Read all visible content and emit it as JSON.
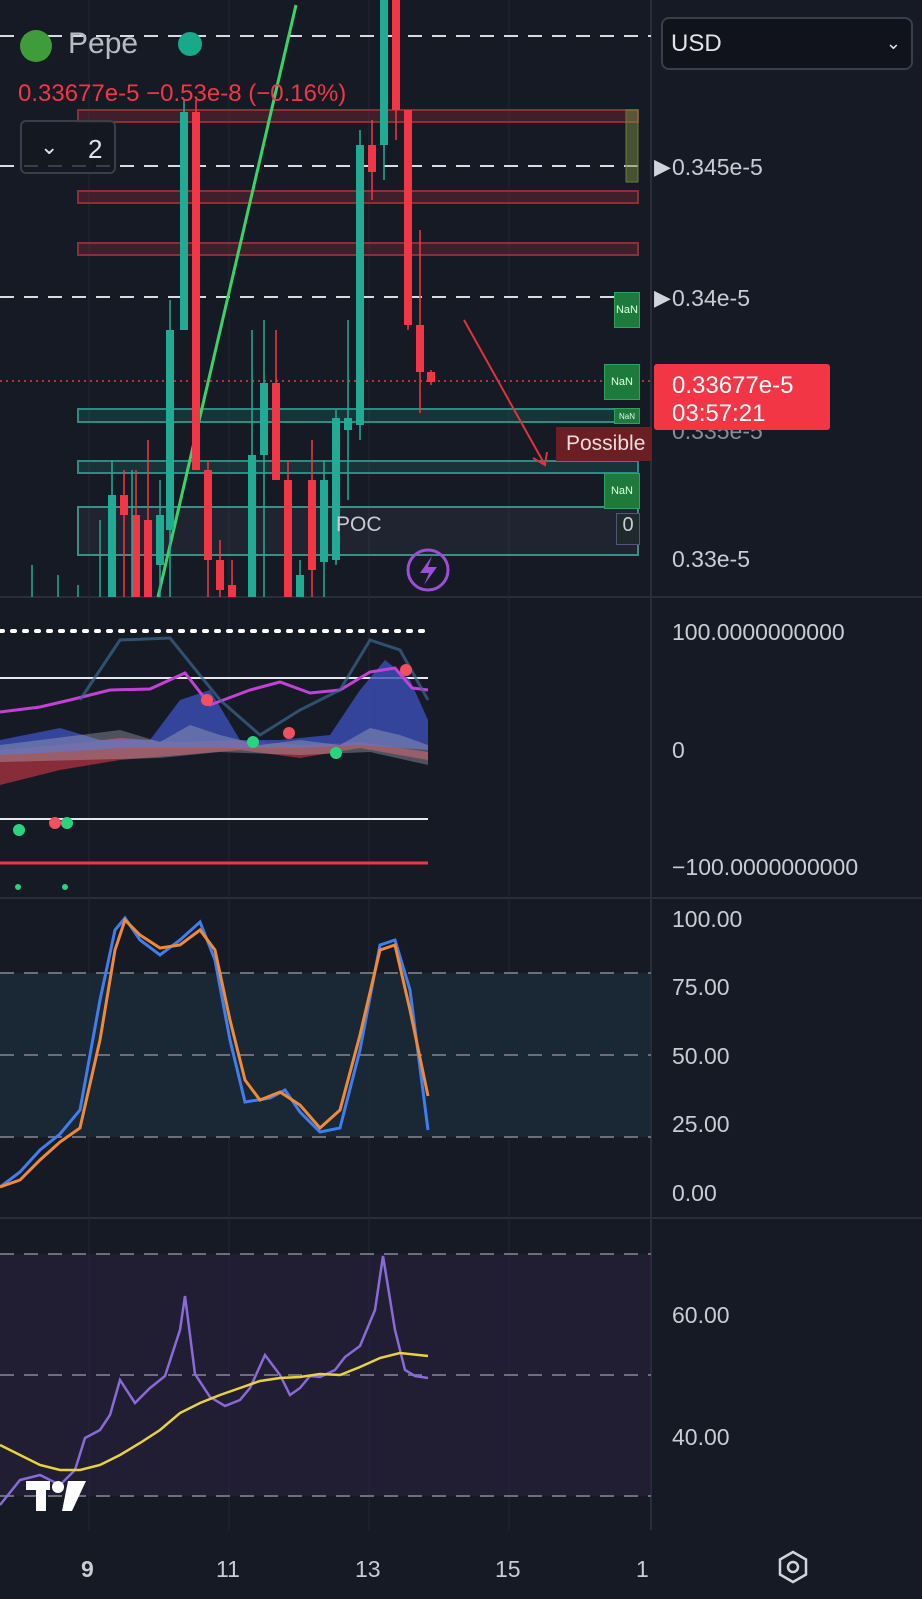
{
  "symbol": {
    "name": "Pepe",
    "quote": "0.33677e-5",
    "change": "−0.53e-8",
    "change_pct": "(−0.16%)",
    "icon": "pepe-frog-icon"
  },
  "legend": {
    "collapsed_count": "2",
    "chevron": "chevron-down-icon"
  },
  "currency": {
    "value": "USD",
    "chevron": "⌄"
  },
  "price_axis": {
    "labels": [
      "0.345e-5",
      "0.34e-5",
      "0.33e-5"
    ],
    "hidden_label": "0.335e-5"
  },
  "last_price": {
    "value": "0.33677e-5",
    "countdown": "03:57:21",
    "color": "#f23645"
  },
  "annotations": {
    "possible": "Possible",
    "poc": "POC",
    "poc_value": "0",
    "nan": "NaN"
  },
  "indicator1_axis": {
    "top": "100.0000000000",
    "mid": "0",
    "bottom": "−100.0000000000"
  },
  "stoch_axis": {
    "labels": [
      "100.00",
      "75.00",
      "50.00",
      "25.00",
      "0.00"
    ]
  },
  "rsi_axis": {
    "labels": [
      "60.00",
      "40.00"
    ]
  },
  "time_axis": {
    "labels": [
      "9",
      "11",
      "13",
      "15",
      "1"
    ]
  },
  "logo": {
    "text": "TV"
  },
  "settings_icon": "hexagon-settings-icon",
  "colors": {
    "up": "#22ab94",
    "down": "#f23645",
    "bg": "#161a25"
  }
}
